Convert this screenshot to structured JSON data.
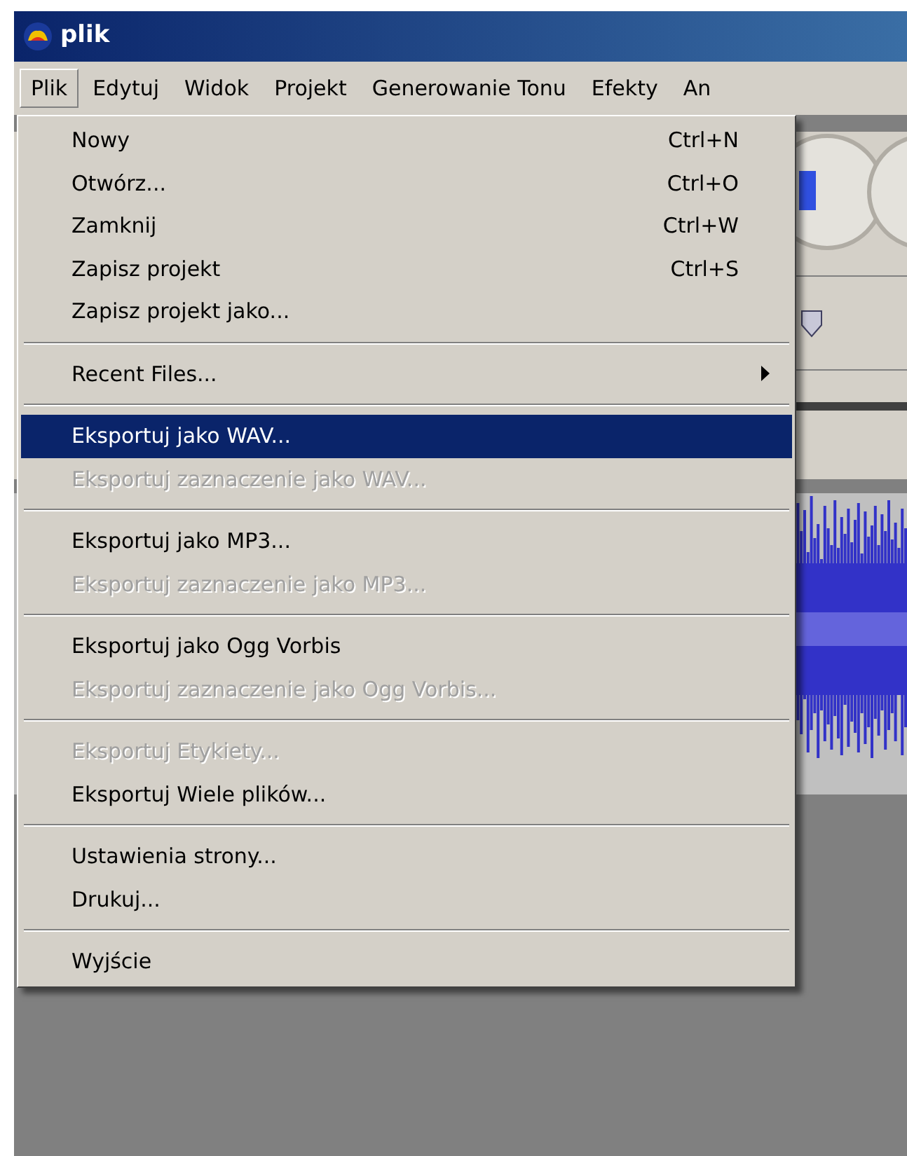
{
  "window": {
    "title": "plik"
  },
  "menubar": [
    {
      "label": "Plik",
      "selected": true
    },
    {
      "label": "Edytuj",
      "selected": false
    },
    {
      "label": "Widok",
      "selected": false
    },
    {
      "label": "Projekt",
      "selected": false
    },
    {
      "label": "Generowanie Tonu",
      "selected": false
    },
    {
      "label": "Efekty",
      "selected": false
    },
    {
      "label": "An",
      "selected": false
    }
  ],
  "menu": [
    {
      "kind": "item",
      "label": "Nowy",
      "shortcut": "Ctrl+N",
      "disabled": false,
      "selected": false
    },
    {
      "kind": "item",
      "label": "Otwórz...",
      "shortcut": "Ctrl+O",
      "disabled": false,
      "selected": false
    },
    {
      "kind": "item",
      "label": "Zamknij",
      "shortcut": "Ctrl+W",
      "disabled": false,
      "selected": false
    },
    {
      "kind": "item",
      "label": "Zapisz projekt",
      "shortcut": "Ctrl+S",
      "disabled": false,
      "selected": false
    },
    {
      "kind": "item",
      "label": "Zapisz projekt jako...",
      "disabled": false,
      "selected": false
    },
    {
      "kind": "separator"
    },
    {
      "kind": "submenu",
      "label": "Recent Files...",
      "disabled": false,
      "selected": false
    },
    {
      "kind": "separator"
    },
    {
      "kind": "item",
      "label": "Eksportuj jako WAV...",
      "disabled": false,
      "selected": true
    },
    {
      "kind": "item",
      "label": "Eksportuj zaznaczenie jako WAV...",
      "disabled": true,
      "selected": false
    },
    {
      "kind": "separator"
    },
    {
      "kind": "item",
      "label": "Eksportuj jako MP3...",
      "disabled": false,
      "selected": false
    },
    {
      "kind": "item",
      "label": "Eksportuj zaznaczenie jako MP3...",
      "disabled": true,
      "selected": false
    },
    {
      "kind": "separator"
    },
    {
      "kind": "item",
      "label": "Eksportuj jako Ogg Vorbis",
      "disabled": false,
      "selected": false
    },
    {
      "kind": "item",
      "label": "Eksportuj zaznaczenie jako Ogg Vorbis...",
      "disabled": true,
      "selected": false
    },
    {
      "kind": "separator"
    },
    {
      "kind": "item",
      "label": "Eksportuj Etykiety...",
      "disabled": true,
      "selected": false
    },
    {
      "kind": "item",
      "label": "Eksportuj Wiele plików...",
      "disabled": false,
      "selected": false
    },
    {
      "kind": "separator"
    },
    {
      "kind": "item",
      "label": "Ustawienia strony...",
      "disabled": false,
      "selected": false
    },
    {
      "kind": "item",
      "label": "Drukuj...",
      "disabled": false,
      "selected": false
    },
    {
      "kind": "separator"
    },
    {
      "kind": "item",
      "label": "Wyjście",
      "disabled": false,
      "selected": false
    }
  ]
}
